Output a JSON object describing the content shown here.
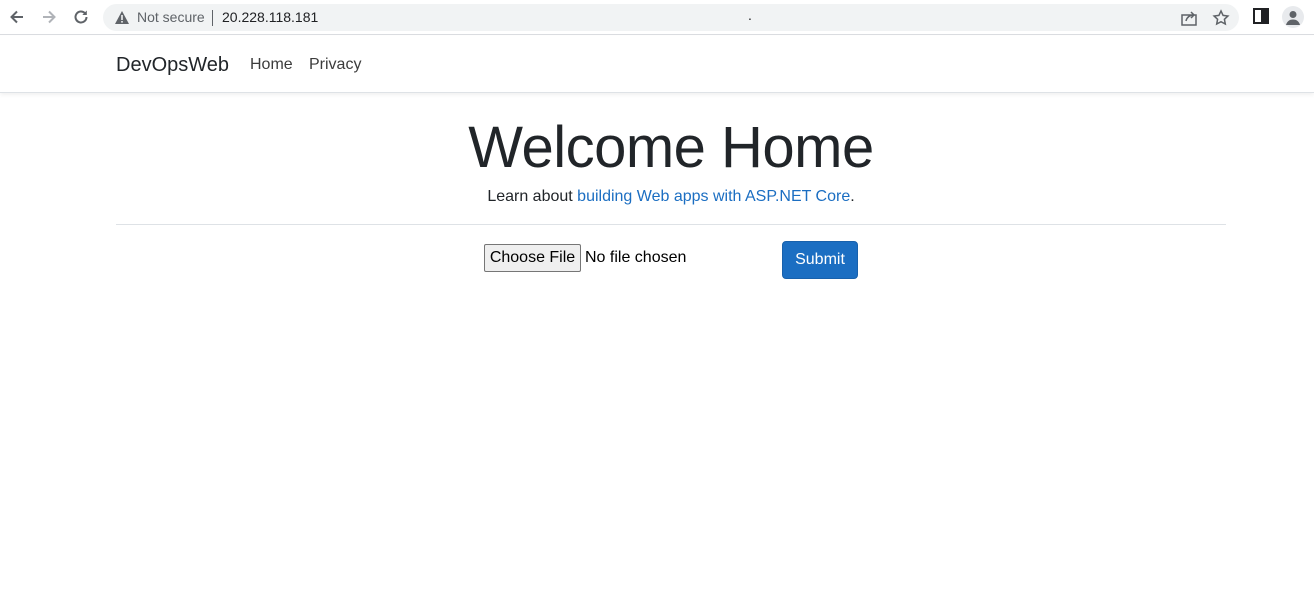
{
  "browser": {
    "security_label": "Not secure",
    "url": "20.228.118.181",
    "stray_dot": "."
  },
  "navbar": {
    "brand": "DevOpsWeb",
    "links": [
      "Home",
      "Privacy"
    ]
  },
  "main": {
    "title": "Welcome Home",
    "lead_prefix": "Learn about ",
    "lead_link": "building Web apps with ASP.NET Core",
    "lead_suffix": ".",
    "file_button": "Choose File",
    "file_status": "No file chosen",
    "submit_label": "Submit"
  },
  "colors": {
    "link": "#1b6ec2",
    "primary_button": "#1b6ec2"
  }
}
